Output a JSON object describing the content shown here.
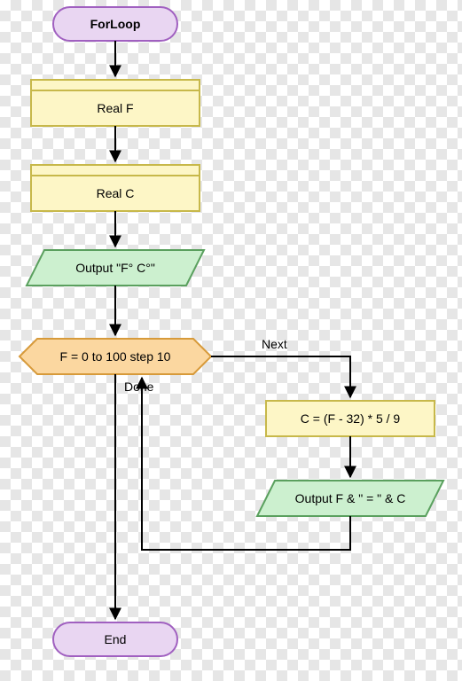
{
  "flow": {
    "start": "ForLoop",
    "declare1": "Real F",
    "declare2": "Real C",
    "output_header": "Output \"F°    C°\"",
    "loop": "F = 0 to 100 step 10",
    "assign": "C = (F - 32) * 5 / 9",
    "output_row": "Output F & \" = \" & C",
    "end": "End",
    "edge_next": "Next",
    "edge_done": "Done"
  },
  "colors": {
    "terminator_fill": "#e9d6f2",
    "terminator_stroke": "#a060c0",
    "declare_fill": "#fdf6c6",
    "declare_stroke": "#c7b84a",
    "io_fill": "#ccf0cf",
    "io_stroke": "#5aa05e",
    "loop_fill": "#fbd7a0",
    "loop_stroke": "#d79a3a",
    "process_fill": "#fdf6c6",
    "process_stroke": "#c7b84a"
  }
}
